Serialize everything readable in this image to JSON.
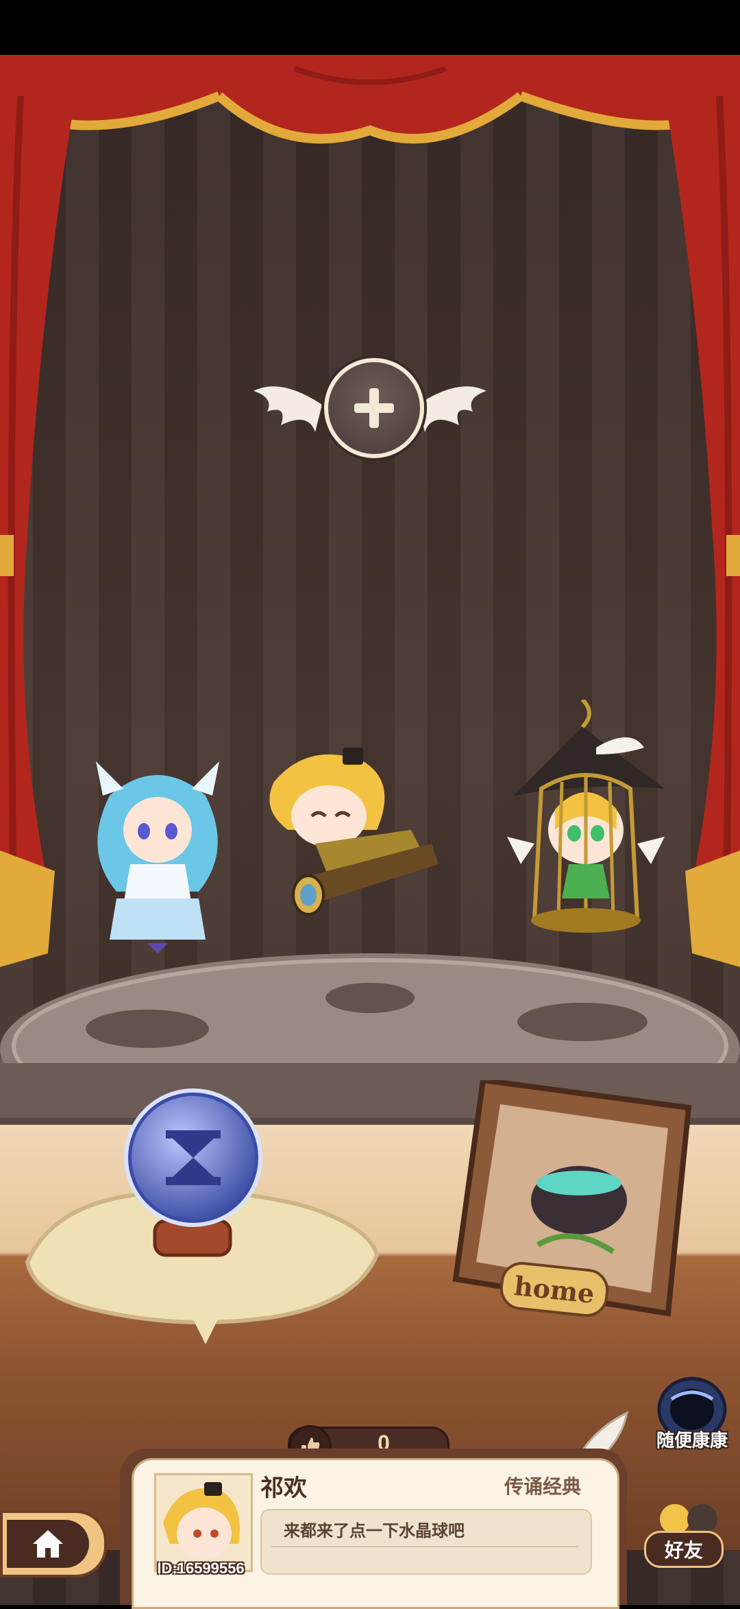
{
  "player": {
    "name": "祁欢",
    "id_text": "ID:16599556",
    "tag": "传诵经典",
    "message": "来都来了点一下水晶球吧"
  },
  "likes": {
    "count": "0"
  },
  "random_visit": {
    "label": "随便康康"
  },
  "friends": {
    "label": "好友"
  },
  "frame": {
    "sign": "home"
  },
  "colors": {
    "curtain": "#b3261e",
    "gold_trim": "#e2a93b",
    "stage_wall": "#3f302b",
    "card_bg": "#fbf3e3",
    "wood": "#8b5331"
  }
}
